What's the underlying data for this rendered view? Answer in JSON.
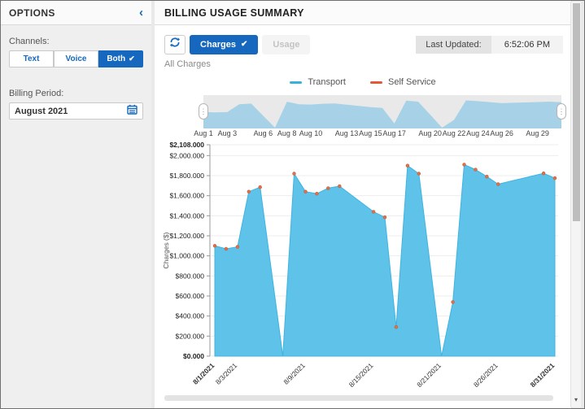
{
  "sidebar": {
    "title": "OPTIONS",
    "collapse_icon": "chevron-left-icon",
    "collapse_glyph": "‹",
    "channels_label": "Channels:",
    "channel_buttons": [
      {
        "label": "Text",
        "active": false,
        "check": ""
      },
      {
        "label": "Voice",
        "active": false,
        "check": ""
      },
      {
        "label": "Both",
        "active": true,
        "check": "✔"
      }
    ],
    "billing_period_label": "Billing Period:",
    "billing_period_value": "August 2021",
    "calendar_icon": "calendar-icon"
  },
  "main": {
    "title": "BILLING USAGE SUMMARY",
    "toolbar": {
      "refresh_icon": "refresh-icon",
      "tabs": [
        {
          "label": "Charges",
          "active": true,
          "check": "✔"
        },
        {
          "label": "Usage",
          "active": false,
          "check": ""
        }
      ],
      "last_updated_label": "Last Updated:",
      "last_updated_value": "6:52:06 PM"
    },
    "subtitle": "All Charges"
  },
  "colors": {
    "accent_blue": "#1568bd",
    "area_fill": "#5fc2e8",
    "area_stroke": "#3eb4e1",
    "nav_area_fill": "#a6d1e6",
    "nav_background": "#e9e9e9",
    "marker_orange": "#e0714a",
    "legend_transport": "#36b1dc",
    "legend_self_service": "#e2583c"
  },
  "chart_data": {
    "type": "area",
    "title": "All Charges",
    "xlabel": "",
    "ylabel": "Charges ($)",
    "ylim": [
      0,
      2108
    ],
    "grid": "horizontal",
    "legend_position": "top-center",
    "categories": [
      "8/1/2021",
      "8/2/2021",
      "8/3/2021",
      "8/4/2021",
      "8/5/2021",
      "8/6/2021",
      "8/7/2021",
      "8/8/2021",
      "8/9/2021",
      "8/10/2021",
      "8/11/2021",
      "8/12/2021",
      "8/13/2021",
      "8/14/2021",
      "8/15/2021",
      "8/16/2021",
      "8/17/2021",
      "8/18/2021",
      "8/19/2021",
      "8/20/2021",
      "8/21/2021",
      "8/22/2021",
      "8/23/2021",
      "8/24/2021",
      "8/25/2021",
      "8/26/2021",
      "8/27/2021",
      "8/28/2021",
      "8/29/2021",
      "8/30/2021",
      "8/31/2021"
    ],
    "series": [
      {
        "name": "Transport",
        "color": "#36b1dc",
        "values": [
          1100,
          1070,
          1090,
          1640,
          1685,
          845,
          0,
          1820,
          1640,
          1620,
          1675,
          1695,
          1610,
          1525,
          1440,
          1385,
          290,
          1900,
          1820,
          910,
          0,
          540,
          1910,
          1860,
          1790,
          1715,
          1742,
          1769,
          1796,
          1823,
          1775
        ]
      },
      {
        "name": "Self Service",
        "color": "#e2583c",
        "role": "point-markers-on-transport"
      }
    ],
    "no_marker_days": [
      6,
      7,
      13,
      14,
      20,
      21,
      27,
      28,
      29
    ],
    "y_ticks": [
      {
        "v": 0,
        "label": "$0.000",
        "bold": true
      },
      {
        "v": 200,
        "label": "$200.000",
        "bold": false
      },
      {
        "v": 400,
        "label": "$400.000",
        "bold": false
      },
      {
        "v": 600,
        "label": "$600.000",
        "bold": false
      },
      {
        "v": 800,
        "label": "$800.000",
        "bold": false
      },
      {
        "v": 1000,
        "label": "$1,000.000",
        "bold": false
      },
      {
        "v": 1200,
        "label": "$1,200.000",
        "bold": false
      },
      {
        "v": 1400,
        "label": "$1,400.000",
        "bold": false
      },
      {
        "v": 1600,
        "label": "$1,600.000",
        "bold": false
      },
      {
        "v": 1800,
        "label": "$1,800.000",
        "bold": false
      },
      {
        "v": 2000,
        "label": "$2,000.000",
        "bold": false
      },
      {
        "v": 2108,
        "label": "$2,108.000",
        "bold": true
      }
    ],
    "x_ticks": [
      {
        "d": 1,
        "label": "8/1/2021",
        "bold": true
      },
      {
        "d": 3,
        "label": "8/3/2021",
        "bold": false
      },
      {
        "d": 9,
        "label": "8/9/2021",
        "bold": false
      },
      {
        "d": 15,
        "label": "8/15/2021",
        "bold": false
      },
      {
        "d": 21,
        "label": "8/21/2021",
        "bold": false
      },
      {
        "d": 26,
        "label": "8/26/2021",
        "bold": false
      },
      {
        "d": 31,
        "label": "8/31/2021",
        "bold": true
      }
    ],
    "navigator_labels": [
      {
        "d": 1,
        "label": "Aug 1"
      },
      {
        "d": 3,
        "label": "Aug 3"
      },
      {
        "d": 6,
        "label": "Aug 6"
      },
      {
        "d": 8,
        "label": "Aug 8"
      },
      {
        "d": 10,
        "label": "Aug 10"
      },
      {
        "d": 13,
        "label": "Aug 13"
      },
      {
        "d": 15,
        "label": "Aug 15"
      },
      {
        "d": 17,
        "label": "Aug 17"
      },
      {
        "d": 20,
        "label": "Aug 20"
      },
      {
        "d": 22,
        "label": "Aug 22"
      },
      {
        "d": 24,
        "label": "Aug 24"
      },
      {
        "d": 26,
        "label": "Aug 26"
      },
      {
        "d": 29,
        "label": "Aug 29"
      }
    ]
  }
}
